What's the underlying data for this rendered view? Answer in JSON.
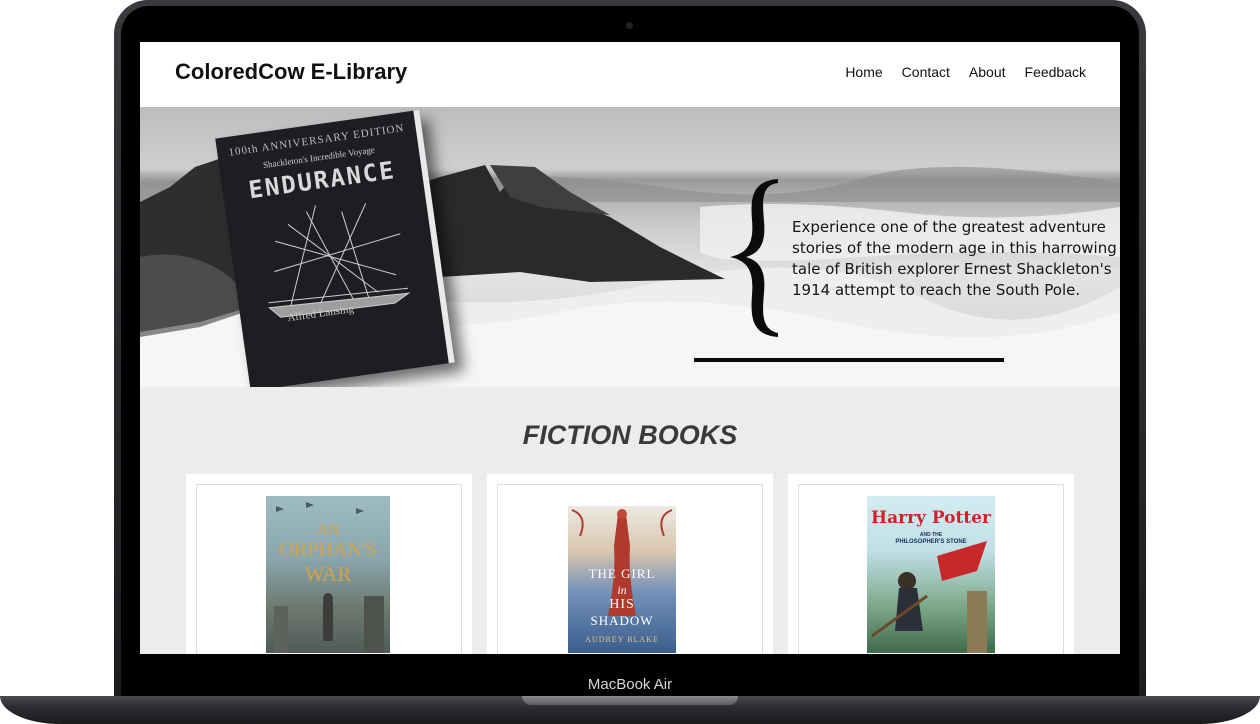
{
  "device": {
    "model_label": "MacBook Air"
  },
  "site": {
    "logo": "ColoredCow E-Library",
    "nav": [
      "Home",
      "Contact",
      "About",
      "Feedback"
    ]
  },
  "hero": {
    "book": {
      "edition": "100th ANNIVERSARY EDITION",
      "subtitle": "Shackleton's Incredible Voyage",
      "title": "ENDURANCE",
      "author": "Alfred Lansing"
    },
    "description": "Experience one of the greatest adventure stories of the modern age in this harrowing tale of British explorer Ernest Shackleton's 1914 attempt to reach the South Pole."
  },
  "section": {
    "title": "FICTION BOOKS"
  },
  "books": [
    {
      "cover_lines": [
        "AN",
        "ORPHAN'S",
        "WAR"
      ],
      "colors": {
        "top": "#8fb0b9",
        "bottom": "#5d6b66",
        "text": "#c99a3c"
      }
    },
    {
      "cover_lines": [
        "THE GIRL",
        "in",
        "HIS",
        "SHADOW"
      ],
      "author": "AUDREY BLAKE",
      "colors": {
        "top": "#e8e5dc",
        "bottom": "#4a6fa0",
        "text": "#ffffff"
      }
    },
    {
      "cover_lines": [
        "Harry Potter",
        "AND THE",
        "PHILOSOPHER'S STONE"
      ],
      "colors": {
        "top": "#c8e3ea",
        "bottom": "#2d5a3c",
        "text": "#d3202a"
      }
    }
  ]
}
